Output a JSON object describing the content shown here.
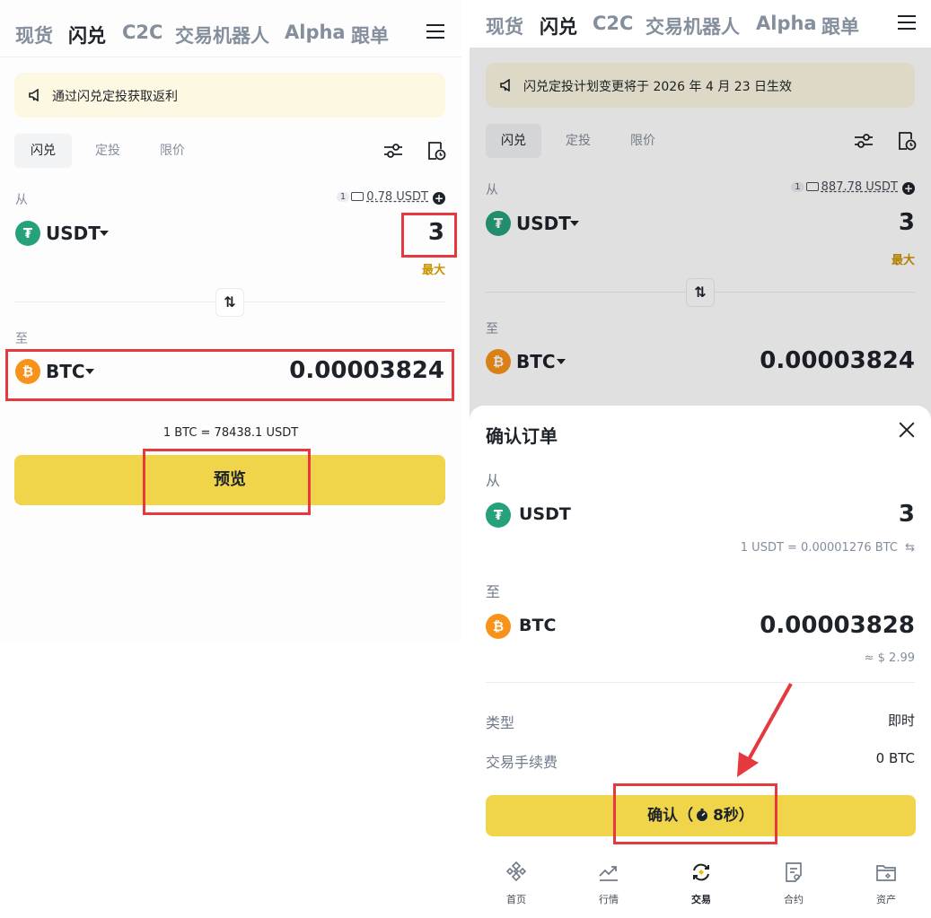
{
  "left": {
    "nav": {
      "tabs": [
        "现货",
        "闪兑",
        "C2C",
        "交易机器人",
        "Alpha",
        "跟单"
      ],
      "active": "闪兑"
    },
    "banner": {
      "text": "通过闪兑定投获取返利"
    },
    "subtabs": [
      "闪兑",
      "定投",
      "限价"
    ],
    "from": {
      "label": "从",
      "balance_badge": "1",
      "balance": "0.78 USDT",
      "coin": "USDT",
      "amount": "3",
      "max_label": "最大"
    },
    "swap_icon": "⇅",
    "to": {
      "label": "至",
      "coin": "BTC",
      "amount": "0.00003824"
    },
    "rate": "1 BTC = 78438.1 USDT",
    "preview_button": "预览"
  },
  "right": {
    "nav": {
      "tabs": [
        "现货",
        "闪兑",
        "C2C",
        "交易机器人",
        "Alpha",
        "跟单"
      ],
      "active": "闪兑"
    },
    "banner": {
      "text": "闪兑定投计划变更将于 2026 年 4 月 23 日生效"
    },
    "subtabs": [
      "闪兑",
      "定投",
      "限价"
    ],
    "from": {
      "label": "从",
      "balance_badge": "1",
      "balance": "887.78 USDT",
      "coin": "USDT",
      "amount": "3",
      "max_label": "最大"
    },
    "to": {
      "label": "至",
      "coin": "BTC",
      "amount": "0.00003824"
    },
    "sheet": {
      "title": "确认订单",
      "from_label": "从",
      "from_coin": "USDT",
      "from_amount": "3",
      "rate": "1 USDT = 0.00001276 BTC",
      "to_label": "至",
      "to_coin": "BTC",
      "to_amount": "0.00003828",
      "usd_value": "≈ $ 2.99",
      "type_label": "类型",
      "type_value": "即时",
      "fee_label": "交易手续费",
      "fee_value": "0 BTC",
      "confirm_prefix": "确认（",
      "confirm_countdown": "8秒",
      "confirm_suffix": "）"
    },
    "bottom_nav": [
      "首页",
      "行情",
      "交易",
      "合约",
      "资产"
    ],
    "bottom_nav_active": "交易"
  },
  "colors": {
    "accent": "#f0d54a",
    "highlight": "#e5393f",
    "usdt": "#26a17b",
    "btc": "#f7931a",
    "max": "#c99400"
  }
}
